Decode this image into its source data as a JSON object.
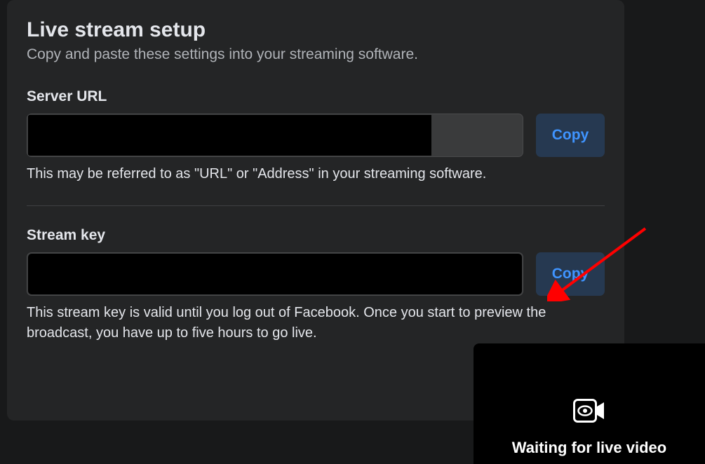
{
  "panel": {
    "title": "Live stream setup",
    "subtitle": "Copy and paste these settings into your streaming software."
  },
  "server_url": {
    "label": "Server URL",
    "copy_label": "Copy",
    "help": "This may be referred to as \"URL\" or \"Address\" in your streaming software."
  },
  "stream_key": {
    "label": "Stream key",
    "copy_label": "Copy",
    "help": "This stream key is valid until you log out of Facebook. Once you start to preview the broadcast, you have up to five hours to go live."
  },
  "preview": {
    "status": "Waiting for live video"
  }
}
